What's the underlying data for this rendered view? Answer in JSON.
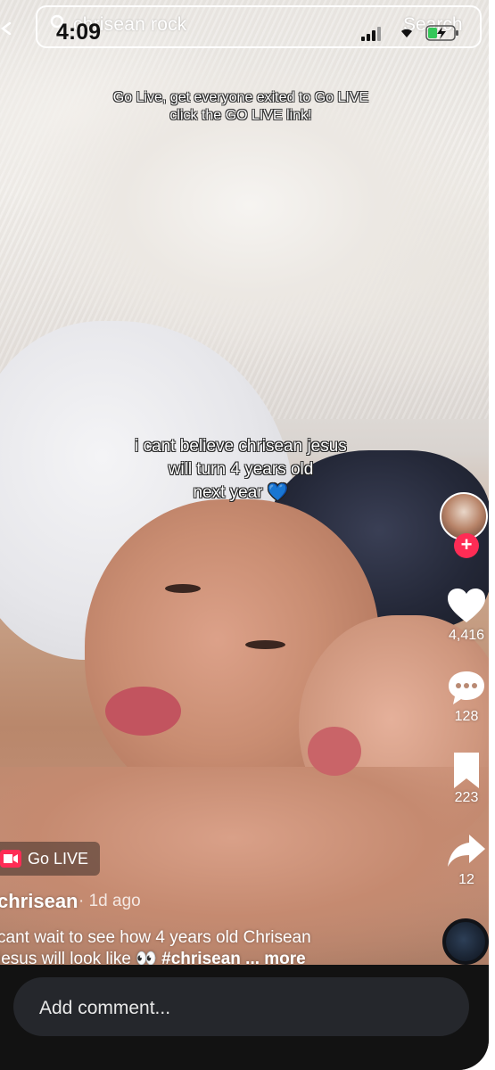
{
  "status_bar": {
    "time": "4:09"
  },
  "search": {
    "query": "chrisean rock",
    "button_label": "Search"
  },
  "video": {
    "overlay_text_line1": "Go Live, get everyone exited to Go LIVE",
    "overlay_text_line2": "click the GO LIVE link!",
    "caption_line1": "i cant believe chrisean jesus",
    "caption_line2": "will turn 4 years old",
    "caption_line3": "next year 💙"
  },
  "actions": {
    "likes": "4,416",
    "comments": "128",
    "saves": "223",
    "shares": "12"
  },
  "live_chip": {
    "label": "Go LIVE"
  },
  "post": {
    "username": "chrisean",
    "time_ago": "· 1d ago",
    "description_line1": "cant wait to see how 4 years old Chrisean",
    "description_line2": "jesus will look like 👀 ",
    "hashtag": "#chrisean",
    "more": " ... more"
  },
  "comment_bar": {
    "placeholder": "Add comment..."
  },
  "colors": {
    "accent": "#fe2c55",
    "bottom_bar": "#121212",
    "comment_box": "#25272c"
  },
  "icons": [
    "back-icon",
    "search-icon",
    "signal-icon",
    "wifi-icon",
    "battery-icon",
    "heart-icon",
    "comment-icon",
    "bookmark-icon",
    "share-icon",
    "live-icon"
  ]
}
